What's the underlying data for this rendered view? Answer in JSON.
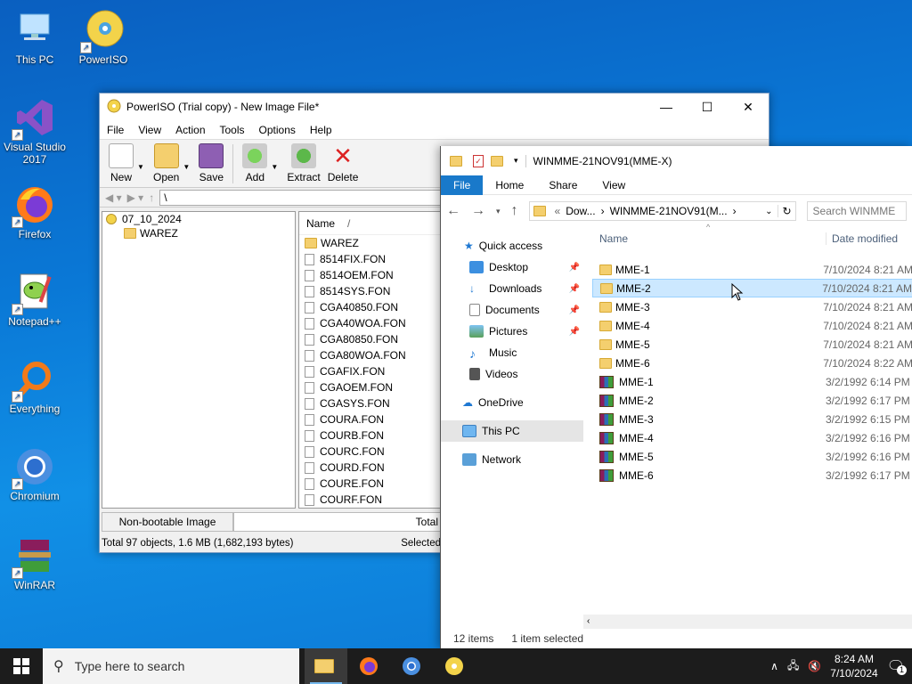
{
  "desktop": {
    "icons": [
      {
        "label": "This PC"
      },
      {
        "label": "PowerISO"
      },
      {
        "label": "Visual Studio 2017"
      },
      {
        "label": "Firefox"
      },
      {
        "label": "Notepad++"
      },
      {
        "label": "Everything"
      },
      {
        "label": "Chromium"
      },
      {
        "label": "WinRAR"
      }
    ]
  },
  "poweriso": {
    "title": "PowerISO (Trial copy) - New Image File*",
    "menu": [
      "File",
      "View",
      "Action",
      "Tools",
      "Options",
      "Help"
    ],
    "toolbar": {
      "new": "New",
      "open": "Open",
      "save": "Save",
      "add": "Add",
      "extract": "Extract",
      "delete": "Delete"
    },
    "address": "\\",
    "tree": {
      "root": "07_10_2024",
      "child": "WAREZ"
    },
    "list": {
      "header": "Name",
      "sort_indicator": "/",
      "items": [
        {
          "name": "WAREZ",
          "type": "folder"
        },
        {
          "name": "8514FIX.FON",
          "type": "file"
        },
        {
          "name": "8514OEM.FON",
          "type": "file"
        },
        {
          "name": "8514SYS.FON",
          "type": "file"
        },
        {
          "name": "CGA40850.FON",
          "type": "file"
        },
        {
          "name": "CGA40WOA.FON",
          "type": "file"
        },
        {
          "name": "CGA80850.FON",
          "type": "file"
        },
        {
          "name": "CGA80WOA.FON",
          "type": "file"
        },
        {
          "name": "CGAFIX.FON",
          "type": "file"
        },
        {
          "name": "CGAOEM.FON",
          "type": "file"
        },
        {
          "name": "CGASYS.FON",
          "type": "file"
        },
        {
          "name": "COURA.FON",
          "type": "file"
        },
        {
          "name": "COURB.FON",
          "type": "file"
        },
        {
          "name": "COURC.FON",
          "type": "file"
        },
        {
          "name": "COURD.FON",
          "type": "file"
        },
        {
          "name": "COURE.FON",
          "type": "file"
        },
        {
          "name": "COURF.FON",
          "type": "file"
        }
      ]
    },
    "status": {
      "boot": "Non-bootable Image",
      "total": "Total",
      "objects": "Total 97 objects, 1.6 MB (1,682,193 bytes)",
      "selected": "Selected"
    }
  },
  "explorer": {
    "title": "WINMME-21NOV91(MME-X)",
    "ribbon": [
      "File",
      "Home",
      "Share",
      "View"
    ],
    "address": {
      "prefix": "«",
      "part1": "Dow...",
      "sep": "›",
      "part2": "WINMME-21NOV91(M...",
      "sep2": "›"
    },
    "search_placeholder": "Search WINMME",
    "nav": {
      "quick_access": "Quick access",
      "desktop": "Desktop",
      "downloads": "Downloads",
      "documents": "Documents",
      "pictures": "Pictures",
      "music": "Music",
      "videos": "Videos",
      "onedrive": "OneDrive",
      "thispc": "This PC",
      "network": "Network"
    },
    "columns": {
      "name": "Name",
      "date": "Date modified"
    },
    "rows": [
      {
        "name": "MME-1",
        "date": "7/10/2024 8:21 AM",
        "type": "folder"
      },
      {
        "name": "MME-2",
        "date": "7/10/2024 8:21 AM",
        "type": "folder"
      },
      {
        "name": "MME-3",
        "date": "7/10/2024 8:21 AM",
        "type": "folder"
      },
      {
        "name": "MME-4",
        "date": "7/10/2024 8:21 AM",
        "type": "folder"
      },
      {
        "name": "MME-5",
        "date": "7/10/2024 8:21 AM",
        "type": "folder"
      },
      {
        "name": "MME-6",
        "date": "7/10/2024 8:22 AM",
        "type": "folder"
      },
      {
        "name": "MME-1",
        "date": "3/2/1992 6:14 PM",
        "type": "rar"
      },
      {
        "name": "MME-2",
        "date": "3/2/1992 6:17 PM",
        "type": "rar"
      },
      {
        "name": "MME-3",
        "date": "3/2/1992 6:15 PM",
        "type": "rar"
      },
      {
        "name": "MME-4",
        "date": "3/2/1992 6:16 PM",
        "type": "rar"
      },
      {
        "name": "MME-5",
        "date": "3/2/1992 6:16 PM",
        "type": "rar"
      },
      {
        "name": "MME-6",
        "date": "3/2/1992 6:17 PM",
        "type": "rar"
      }
    ],
    "status": {
      "items": "12 items",
      "selected": "1 item selected"
    }
  },
  "taskbar": {
    "search_placeholder": "Type here to search",
    "time": "8:24 AM",
    "date": "7/10/2024",
    "notifications": "1"
  }
}
